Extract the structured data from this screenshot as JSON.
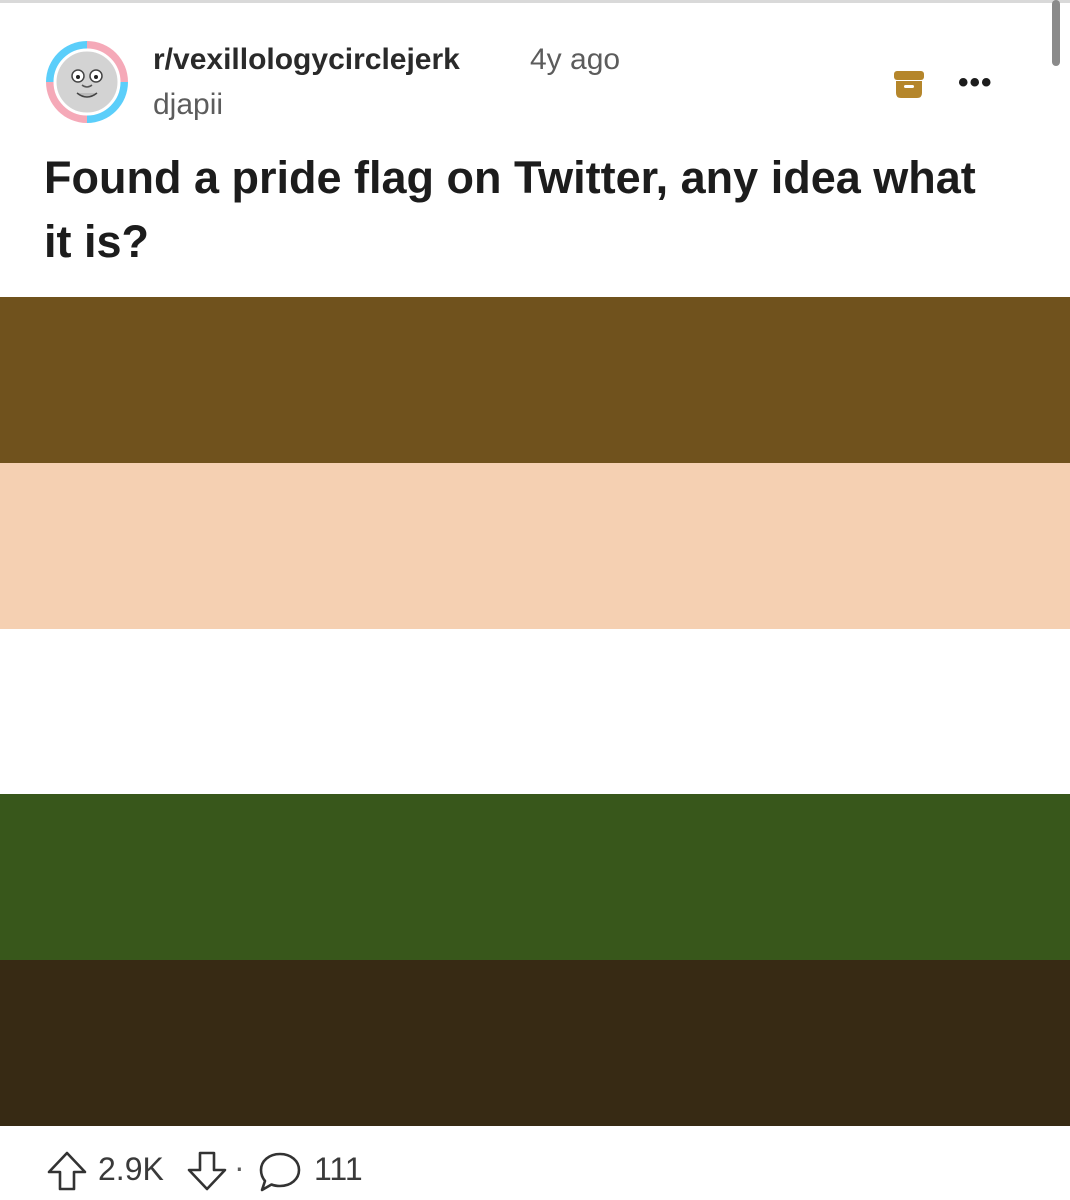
{
  "post": {
    "subreddit": "r/vexillologycirclejerk",
    "time_ago": "4y ago",
    "author": "djapii",
    "title": "Found a pride flag on Twitter, any idea what it is?"
  },
  "flag": {
    "stripes": [
      {
        "color": "#70521d"
      },
      {
        "color": "#f5d0b2"
      },
      {
        "color": "#ffffff"
      },
      {
        "color": "#38571b"
      },
      {
        "color": "#372a14"
      }
    ]
  },
  "footer": {
    "score": "2.9K",
    "separator": "·",
    "comment_count": "111"
  },
  "icons": {
    "archive": "archive-icon",
    "more": "more-options-icon",
    "upvote": "upvote-arrow-icon",
    "downvote": "downvote-arrow-icon",
    "comment": "comment-bubble-icon"
  },
  "colors": {
    "archive_icon": "#b5862b",
    "avatar_ring_pink": "#f5a9b8",
    "avatar_ring_blue": "#5bcefa"
  }
}
